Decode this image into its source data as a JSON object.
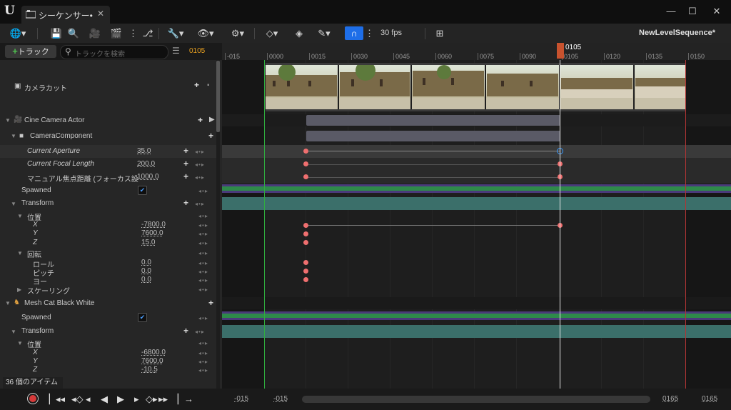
{
  "window": {
    "logo": "U",
    "tab_title": "シーケンサー•",
    "tab_close": "✕",
    "minimize": "—",
    "maximize": "☐",
    "close": "✕"
  },
  "toolbar": {
    "fps_label": "30 fps",
    "sequence_name": "NewLevelSequence*"
  },
  "filter": {
    "add_track_plus": "+",
    "add_track_label": "トラック",
    "search_placeholder": "トラックを検索",
    "current_frame": "0105"
  },
  "ruler": {
    "ticks": [
      "-015",
      "0000",
      "0015",
      "0030",
      "0045",
      "0060",
      "0075",
      "0090",
      "0105",
      "0120",
      "0135",
      "0150"
    ],
    "playhead_frame": "0105"
  },
  "tree": {
    "camera_cut": "カメラカット",
    "cine_camera": "Cine Camera Actor",
    "camera_component": "CameraComponent",
    "current_aperture": {
      "label": "Current Aperture",
      "value": "35.0"
    },
    "current_focal": {
      "label": "Current Focal Length",
      "value": "200.0"
    },
    "manual_focus": {
      "label": "マニュアル焦点距離 (フォーカス設",
      "value": "1000.0"
    },
    "spawned1": "Spawned",
    "transform1": "Transform",
    "position1": "位置",
    "x1": {
      "label": "X",
      "value": "-7800.0"
    },
    "y1": {
      "label": "Y",
      "value": "7600.0"
    },
    "z1": {
      "label": "Z",
      "value": "15.0"
    },
    "rotation": "回転",
    "roll": {
      "label": "ロール",
      "value": "0.0"
    },
    "pitch": {
      "label": "ピッチ",
      "value": "0.0"
    },
    "yaw": {
      "label": "ヨー",
      "value": "0.0"
    },
    "scaling": "スケーリング",
    "mesh_cat": "Mesh Cat Black White",
    "spawned2": "Spawned",
    "transform2": "Transform",
    "position2": "位置",
    "x2": {
      "label": "X",
      "value": "-6800.0"
    },
    "y2": {
      "label": "Y",
      "value": "7600.0"
    },
    "z2": {
      "label": "Z",
      "value": "-10.5"
    }
  },
  "footer": {
    "item_count": "36 個のアイテム",
    "range_start_1": "-015",
    "range_start_2": "-015",
    "range_end_1": "0165",
    "range_end_2": "0165"
  },
  "colors": {
    "accent": "#1e6ee8",
    "playhead": "#c8522e",
    "key": "#ef6f6f",
    "selected_key": "#3a9bff",
    "spawn_green": "#2e8a4a",
    "transform_teal": "#3b6f6a"
  }
}
